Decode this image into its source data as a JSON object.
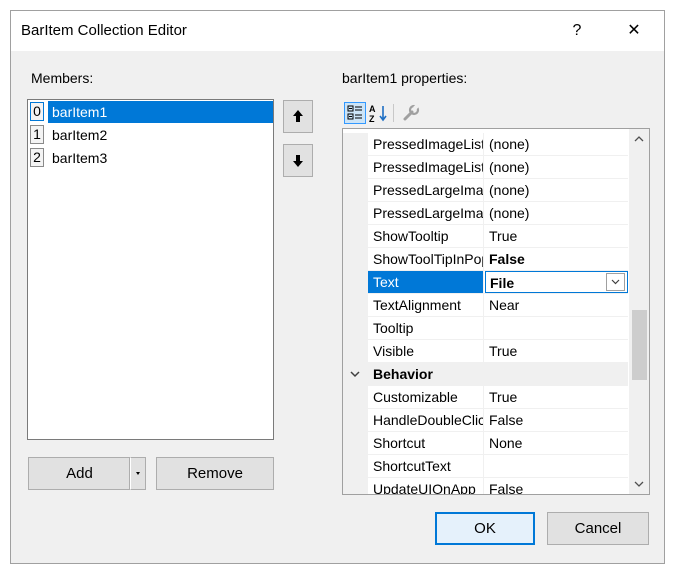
{
  "window": {
    "title": "BarItem Collection Editor",
    "help_glyph": "?",
    "close_glyph": "✕"
  },
  "members": {
    "label": "Members:",
    "items": [
      {
        "index": "0",
        "name": "barItem1",
        "selected": true
      },
      {
        "index": "1",
        "name": "barItem2",
        "selected": false
      },
      {
        "index": "2",
        "name": "barItem3",
        "selected": false
      }
    ],
    "add_label": "Add",
    "remove_label": "Remove"
  },
  "properties": {
    "label": "barItem1 properties:",
    "rows": [
      {
        "name": "PressedImageList",
        "value": "(none)"
      },
      {
        "name": "PressedImageList",
        "value": "(none)"
      },
      {
        "name": "PressedLargeImage",
        "value": "(none)"
      },
      {
        "name": "PressedLargeImage",
        "value": "(none)"
      },
      {
        "name": "ShowTooltip",
        "value": "True"
      },
      {
        "name": "ShowToolTipInPopup",
        "value": "False",
        "bold": true
      },
      {
        "name": "Text",
        "value": "File",
        "selected": true
      },
      {
        "name": "TextAlignment",
        "value": "Near"
      },
      {
        "name": "Tooltip",
        "value": ""
      },
      {
        "name": "Visible",
        "value": "True"
      },
      {
        "name": "Behavior",
        "category": true
      },
      {
        "name": "Customizable",
        "value": "True"
      },
      {
        "name": "HandleDoubleClick",
        "value": "False"
      },
      {
        "name": "Shortcut",
        "value": "None"
      },
      {
        "name": "ShortcutText",
        "value": ""
      },
      {
        "name": "UpdateUIOnApp",
        "value": "False"
      }
    ]
  },
  "buttons": {
    "ok_label": "OK",
    "cancel_label": "Cancel"
  },
  "colors": {
    "accent": "#0078d7",
    "dialog_bg": "#f0f0f0"
  }
}
